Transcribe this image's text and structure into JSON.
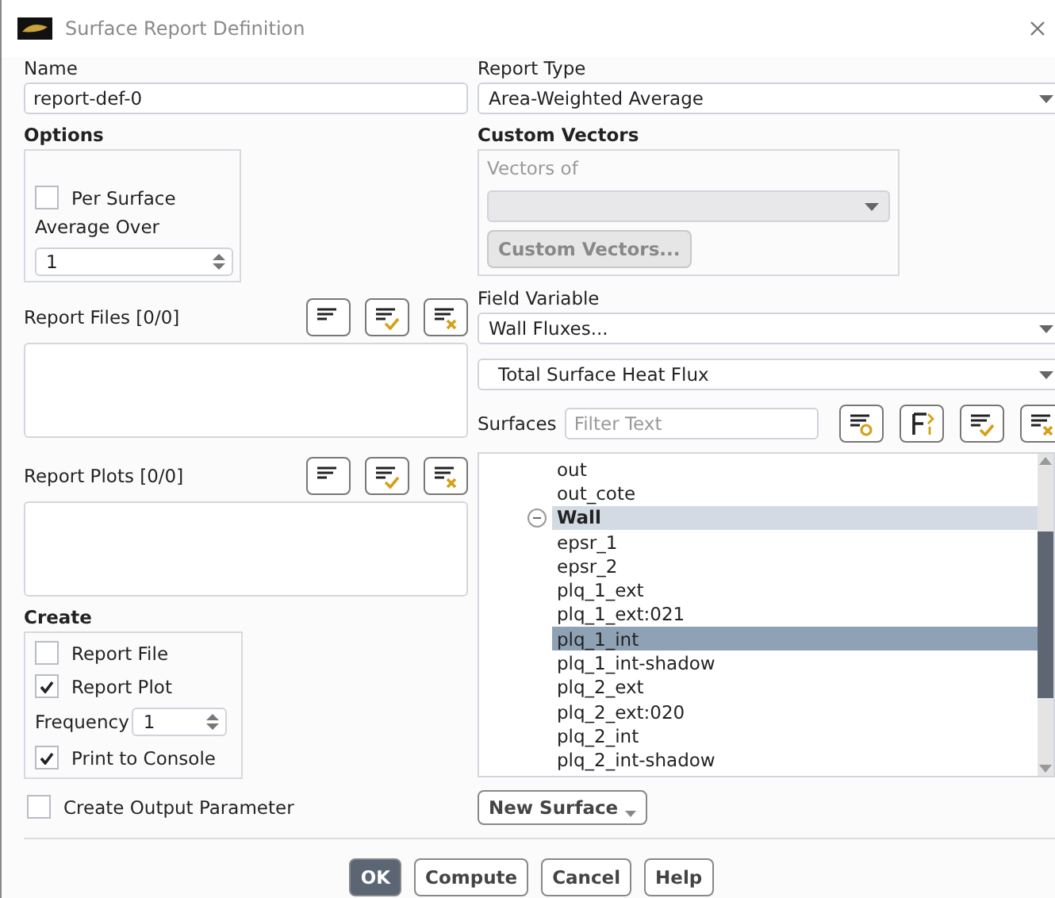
{
  "window": {
    "title": "Surface Report Definition"
  },
  "name": {
    "label": "Name",
    "value": "report-def-0"
  },
  "options": {
    "label": "Options",
    "per_surface": {
      "label": "Per Surface",
      "checked": false
    },
    "average_over": {
      "label": "Average Over",
      "value": "1"
    }
  },
  "report_files": {
    "label": "Report Files [0/0]"
  },
  "report_plots": {
    "label": "Report Plots [0/0]"
  },
  "create": {
    "label": "Create",
    "items": [
      {
        "kind": "checkbox",
        "label": "Report File",
        "checked": false
      },
      {
        "kind": "checkbox",
        "label": "Report Plot",
        "checked": true
      },
      {
        "kind": "spinner",
        "label": "Frequency",
        "value": "1"
      },
      {
        "kind": "checkbox",
        "label": "Print to Console",
        "checked": true
      }
    ]
  },
  "create_output_parameter": {
    "label": "Create Output Parameter",
    "checked": false
  },
  "report_type": {
    "label": "Report Type",
    "value": "Area-Weighted Average"
  },
  "custom_vectors": {
    "label": "Custom Vectors",
    "vectors_of": {
      "label": "Vectors of",
      "disabled": true
    },
    "button": {
      "label": "Custom Vectors...",
      "disabled": true
    }
  },
  "field_variable": {
    "label": "Field Variable",
    "value": "Wall Fluxes...",
    "sub_value": "Total Surface Heat Flux"
  },
  "surfaces": {
    "label": "Surfaces",
    "placeholder": "Filter Text",
    "items": [
      {
        "label": "out",
        "selected": false
      },
      {
        "label": "out_cote",
        "selected": false
      },
      {
        "label": "Wall",
        "selected": false,
        "expanded": true,
        "children": [
          {
            "label": "epsr_1",
            "selected": false
          },
          {
            "label": "epsr_2",
            "selected": false
          },
          {
            "label": "plq_1_ext",
            "selected": false
          },
          {
            "label": "plq_1_ext:021",
            "selected": false
          },
          {
            "label": "plq_1_int",
            "selected": true
          },
          {
            "label": "plq_1_int-shadow",
            "selected": false
          },
          {
            "label": "plq_2_ext",
            "selected": false
          },
          {
            "label": "plq_2_ext:020",
            "selected": false
          },
          {
            "label": "plq_2_int",
            "selected": false
          },
          {
            "label": "plq_2_int-shadow",
            "selected": false
          }
        ]
      }
    ]
  },
  "new_surface": {
    "label": "New Surface"
  },
  "buttons": [
    {
      "label": "OK",
      "default": true
    },
    {
      "label": "Compute",
      "default": false
    },
    {
      "label": "Cancel",
      "default": false
    },
    {
      "label": "Help",
      "default": false
    }
  ]
}
